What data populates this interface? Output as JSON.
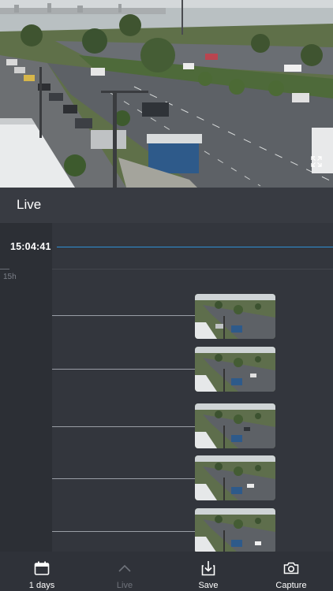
{
  "live_bar": {
    "title": "Live"
  },
  "timeline": {
    "current_time": "15:04:41",
    "hour_marker": "15h",
    "events": [
      {
        "thumbnail": "camera-snapshot"
      },
      {
        "thumbnail": "camera-snapshot"
      },
      {
        "thumbnail": "camera-snapshot"
      },
      {
        "thumbnail": "camera-snapshot"
      },
      {
        "thumbnail": "camera-snapshot"
      }
    ]
  },
  "bottom_nav": {
    "days": {
      "label": "1 days",
      "icon": "calendar-icon"
    },
    "live": {
      "label": "Live",
      "icon": "chevron-up-icon",
      "enabled": false
    },
    "save": {
      "label": "Save",
      "icon": "download-icon"
    },
    "capture": {
      "label": "Capture",
      "icon": "camera-icon"
    }
  },
  "colors": {
    "accent": "#2f8fd6",
    "background": "#2f3239",
    "timeline_bg": "#33363d",
    "disabled_text": "#6f737b"
  }
}
